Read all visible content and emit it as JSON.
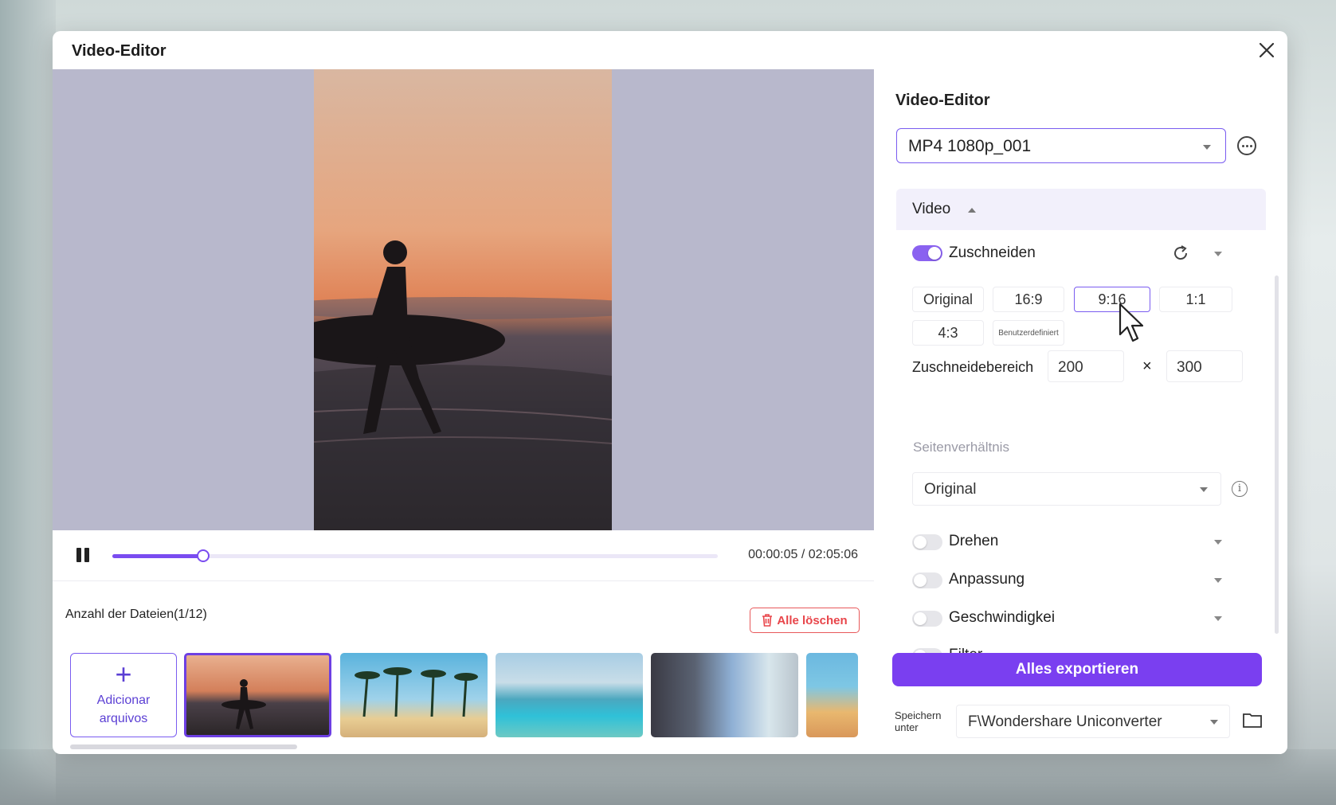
{
  "window": {
    "title": "Video-Editor"
  },
  "player": {
    "time": "00:00:05 / 02:05:06",
    "progress": 0.15
  },
  "files": {
    "count_label": "Anzahl der Dateien(1/12)",
    "delete_all": "Alle löschen",
    "add_label_line1": "Adicionar",
    "add_label_line2": "arquivos"
  },
  "panel": {
    "title": "Video-Editor",
    "preset": "MP4 1080p_001",
    "section": "Video",
    "crop": {
      "label": "Zuschneiden",
      "enabled": true,
      "ratios": [
        "Original",
        "16:9",
        "9:16",
        "1:1",
        "4:3",
        "Benutzerdefiniert"
      ],
      "selected": "9:16",
      "area_label": "Zuschneidebereich",
      "width": "200",
      "height": "300",
      "times": "×"
    },
    "aspect": {
      "label": "Seitenverhältnis",
      "value": "Original"
    },
    "options": [
      {
        "label": "Drehen",
        "enabled": false
      },
      {
        "label": "Anpassung",
        "enabled": false
      },
      {
        "label": "Geschwindigkei",
        "enabled": false
      },
      {
        "label": "Filter",
        "enabled": false
      }
    ]
  },
  "footer": {
    "export": "Alles exportieren",
    "save_label_line1": "Speichern",
    "save_label_line2": "unter",
    "save_path": "F\\Wondershare Uniconverter"
  },
  "colors": {
    "accent": "#7a3ff0",
    "danger": "#e8454a",
    "preview_bg": "#b8b8cc"
  }
}
